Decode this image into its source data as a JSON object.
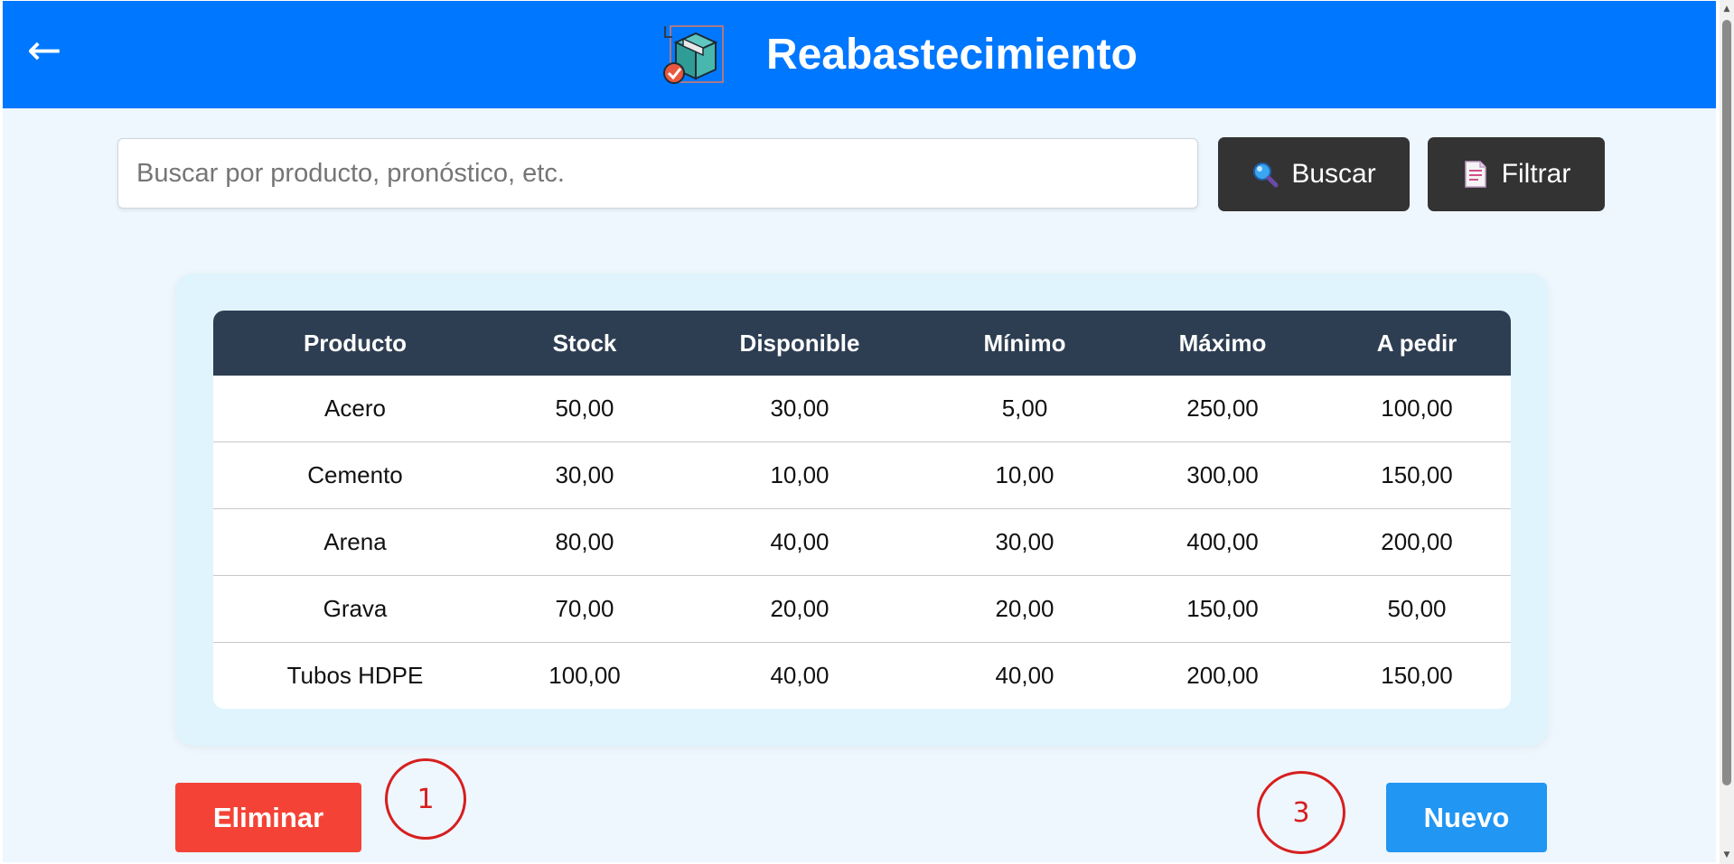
{
  "header": {
    "back_icon": "←",
    "logo": "box-restock-icon",
    "title": "Reabastecimiento",
    "background": "#0077ff"
  },
  "search": {
    "placeholder": "Buscar por producto, pronóstico, etc.",
    "value": "",
    "search_button": "Buscar",
    "search_icon": "magnifier-icon",
    "filter_button": "Filtrar",
    "filter_icon": "document-filter-icon"
  },
  "table": {
    "columns": [
      "Producto",
      "Stock",
      "Disponible",
      "Mínimo",
      "Máximo",
      "A pedir"
    ],
    "rows": [
      [
        "Acero",
        "50,00",
        "30,00",
        "5,00",
        "250,00",
        "100,00"
      ],
      [
        "Cemento",
        "30,00",
        "10,00",
        "10,00",
        "300,00",
        "150,00"
      ],
      [
        "Arena",
        "80,00",
        "40,00",
        "30,00",
        "400,00",
        "200,00"
      ],
      [
        "Grava",
        "70,00",
        "20,00",
        "20,00",
        "150,00",
        "50,00"
      ],
      [
        "Tubos HDPE",
        "100,00",
        "40,00",
        "40,00",
        "200,00",
        "150,00"
      ]
    ],
    "header_color": "#2e3e52"
  },
  "actions": {
    "delete_label": "Eliminar",
    "delete_color": "#f44336",
    "new_label": "Nuevo",
    "new_color": "#2196f3"
  },
  "annotations": {
    "marker_1": "1",
    "marker_3": "3",
    "color": "#d61f1f"
  }
}
